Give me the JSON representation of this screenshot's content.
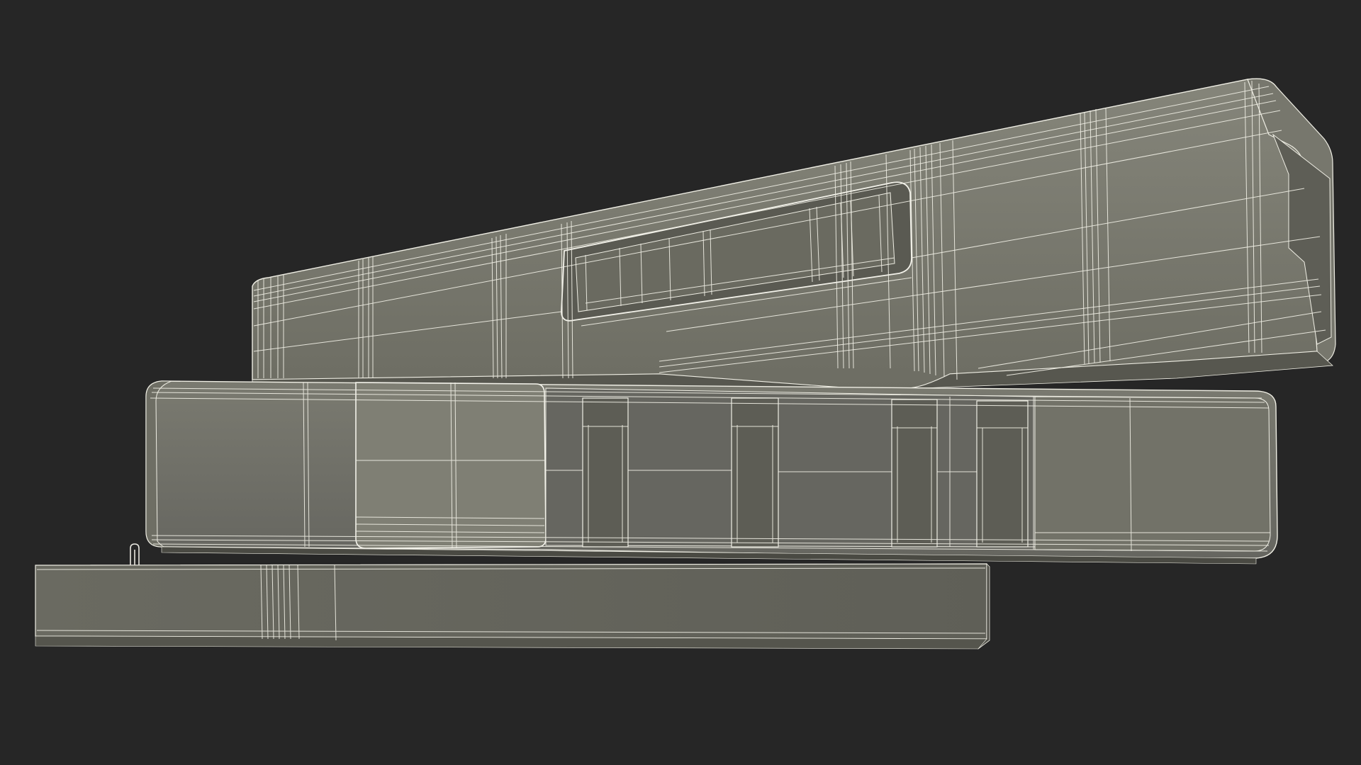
{
  "scene": {
    "subject": "wireframe-house-model",
    "colors": {
      "background": "#262626",
      "surface_light": "#7d7d72",
      "surface_mid": "#6f6f64",
      "surface_dark": "#5b5b52",
      "surface_shadow": "#4b4b43",
      "wire": "#efeee4"
    }
  }
}
